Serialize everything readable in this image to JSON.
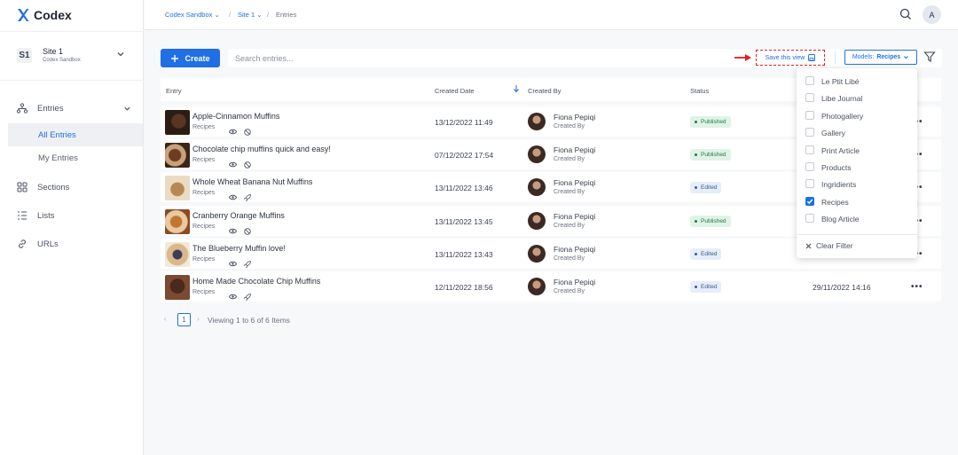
{
  "app": {
    "name": "Codex",
    "brand_color": "#1f6fe5"
  },
  "breadcrumb": {
    "workspace": "Codex Sandbox",
    "site": "Site 1",
    "current": "Entries",
    "separator": "/"
  },
  "user": {
    "initial": "A"
  },
  "site": {
    "badge": "S1",
    "name": "Site 1",
    "org": "Codex Sandbox"
  },
  "sidebar": {
    "entries": "Entries",
    "all_entries": "All Entries",
    "my_entries": "My Entries",
    "sections": "Sections",
    "lists": "Lists",
    "urls": "URLs"
  },
  "toolbar": {
    "create_label": "Create",
    "search_placeholder": "Search entries...",
    "save_view_label": "Save this view",
    "models_prefix": "Models:",
    "models_value": "Recipes"
  },
  "table": {
    "headers": {
      "entry": "Entry",
      "created_date": "Created Date",
      "created_by": "Created By",
      "status": "Status"
    },
    "rows": [
      {
        "title": "Apple-Cinnamon Muffins",
        "model": "Recipes",
        "created": "13/12/2022 11:49",
        "author": "Fiona Pepiqi",
        "role": "Created By",
        "status": "Published",
        "status_type": "pub",
        "updated": "",
        "second_icon": "ban-icon"
      },
      {
        "title": "Chocolate chip muffins quick and easy!",
        "model": "Recipes",
        "created": "07/12/2022 17:54",
        "author": "Fiona Pepiqi",
        "role": "Created By",
        "status": "Published",
        "status_type": "pub",
        "updated": "",
        "second_icon": "ban-icon"
      },
      {
        "title": "Whole Wheat Banana Nut Muffins",
        "model": "Recipes",
        "created": "13/11/2022 13:46",
        "author": "Fiona Pepiqi",
        "role": "Created By",
        "status": "Edited",
        "status_type": "edit",
        "updated": "",
        "second_icon": "rocket-icon"
      },
      {
        "title": "Cranberry Orange Muffins",
        "model": "Recipes",
        "created": "13/11/2022 13:45",
        "author": "Fiona Pepiqi",
        "role": "Created By",
        "status": "Published",
        "status_type": "pub",
        "updated": "",
        "second_icon": "ban-icon"
      },
      {
        "title": "The Blueberry Muffin love!",
        "model": "Recipes",
        "created": "13/11/2022 13:43",
        "author": "Fiona Pepiqi",
        "role": "Created By",
        "status": "Edited",
        "status_type": "edit",
        "updated": "",
        "second_icon": "rocket-icon"
      },
      {
        "title": "Home Made Chocolate Chip Muffins",
        "model": "Recipes",
        "created": "12/11/2022 18:56",
        "author": "Fiona Pepiqi",
        "role": "Created By",
        "status": "Edited",
        "status_type": "edit",
        "updated": "29/11/2022 14:16",
        "second_icon": "rocket-icon"
      }
    ]
  },
  "pagination": {
    "page": "1",
    "info": "Viewing 1 to 6 of 6 Items"
  },
  "models_dropdown": {
    "options": [
      {
        "label": "Le Ptit Libé",
        "checked": false
      },
      {
        "label": "Libe Journal",
        "checked": false
      },
      {
        "label": "Photogallery",
        "checked": false
      },
      {
        "label": "Gallery",
        "checked": false
      },
      {
        "label": "Print Article",
        "checked": false
      },
      {
        "label": "Products",
        "checked": false
      },
      {
        "label": "Ingridients",
        "checked": false
      },
      {
        "label": "Recipes",
        "checked": true
      },
      {
        "label": "Blog Article",
        "checked": false
      }
    ],
    "clear_label": "Clear Filter"
  }
}
